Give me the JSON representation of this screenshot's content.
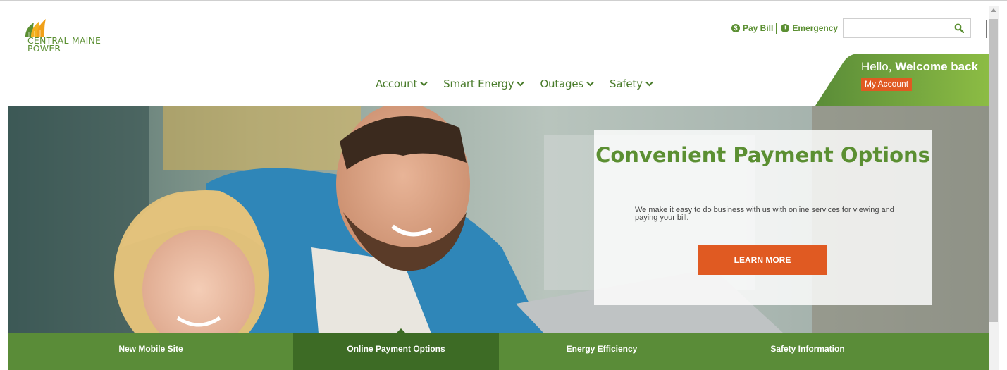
{
  "header": {
    "logo_line1": "CENTRAL MAINE",
    "logo_line2": "POWER",
    "pay_bill_label": "Pay Bill",
    "emergency_label": "Emergency",
    "search_placeholder": "",
    "greeting_prefix": "Hello,",
    "greeting_name": "Welcome back",
    "my_account_label": "My Account"
  },
  "nav": {
    "items": [
      {
        "label": "Account"
      },
      {
        "label": "Smart Energy"
      },
      {
        "label": "Outages"
      },
      {
        "label": "Safety"
      }
    ]
  },
  "promo": {
    "title": "Convenient Payment Options",
    "body": "We make it easy to do business with us with online services for viewing and paying your bill.",
    "button_label": "LEARN MORE"
  },
  "tabs": [
    {
      "label": "New Mobile Site"
    },
    {
      "label": "Online Payment Options"
    },
    {
      "label": "Energy Efficiency"
    },
    {
      "label": "Safety Information"
    }
  ],
  "colors": {
    "brand_green": "#5b8f32",
    "dark_green": "#3d6b25",
    "accent_orange": "#e05a22"
  }
}
